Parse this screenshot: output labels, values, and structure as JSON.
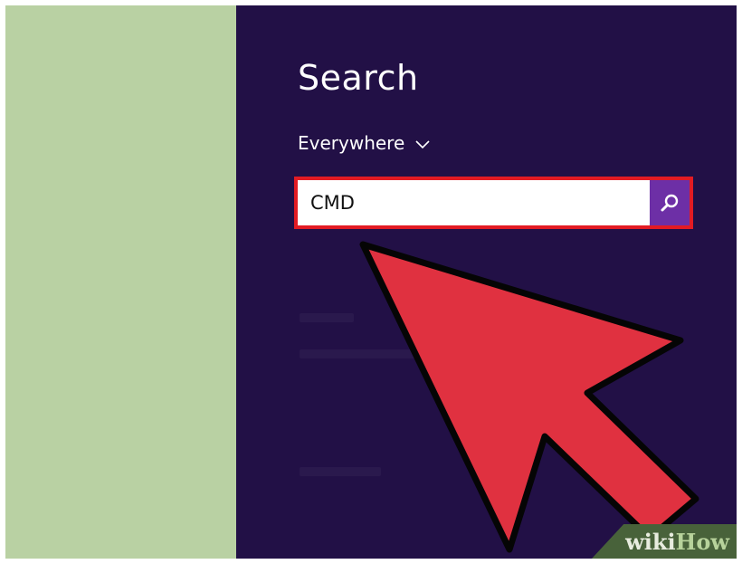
{
  "colors": {
    "left_panel": "#b9d1a3",
    "search_pane": "#221046",
    "search_button": "#6d2fa6",
    "highlight_border": "#e31b23",
    "arrow_fill": "#e03140",
    "arrow_outline": "#050505",
    "watermark_bg": "#48623a",
    "watermark_wiki": "#e8ecdf",
    "watermark_how": "#b7d29b"
  },
  "search_pane": {
    "title": "Search",
    "scope": {
      "label": "Everywhere",
      "icon": "chevron-down-icon"
    },
    "search_box": {
      "value": "CMD",
      "button_icon": "search-icon"
    }
  },
  "annotation": {
    "icon": "pointer-arrow"
  },
  "watermark": {
    "wiki": "wiki",
    "how": "How"
  }
}
